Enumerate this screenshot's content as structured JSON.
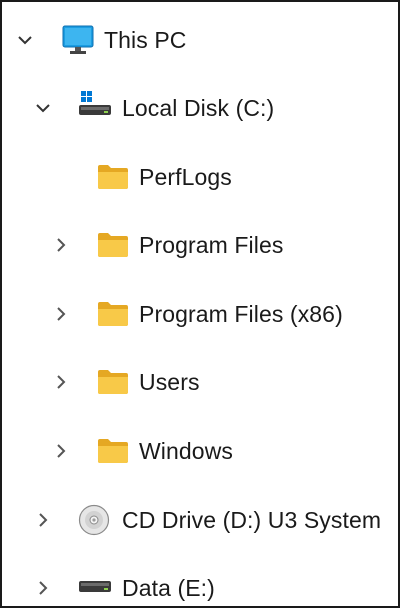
{
  "tree": {
    "this_pc": {
      "label": "This PC",
      "icon": "monitor-icon",
      "expanded": true
    },
    "local_disk": {
      "label": "Local Disk (C:)",
      "icon": "windows-drive-icon",
      "expanded": true
    },
    "folders": [
      {
        "label": "PerfLogs",
        "icon": "folder-icon",
        "has_children": false
      },
      {
        "label": "Program Files",
        "icon": "folder-icon",
        "has_children": true
      },
      {
        "label": "Program Files (x86)",
        "icon": "folder-icon",
        "has_children": true
      },
      {
        "label": "Users",
        "icon": "folder-icon",
        "has_children": true
      },
      {
        "label": "Windows",
        "icon": "folder-icon",
        "has_children": true
      }
    ],
    "cd_drive": {
      "label": "CD Drive (D:) U3 System",
      "icon": "cd-drive-icon",
      "expanded": false
    },
    "data_drive": {
      "label": "Data (E:)",
      "icon": "drive-icon",
      "expanded": false
    }
  },
  "colors": {
    "folder": "#F8C948",
    "folder_dark": "#E5A823",
    "monitor": "#1B9DE2",
    "windows_logo": "#0078D4",
    "drive": "#333333",
    "text": "#1A1A1A",
    "chevron": "#555555"
  }
}
